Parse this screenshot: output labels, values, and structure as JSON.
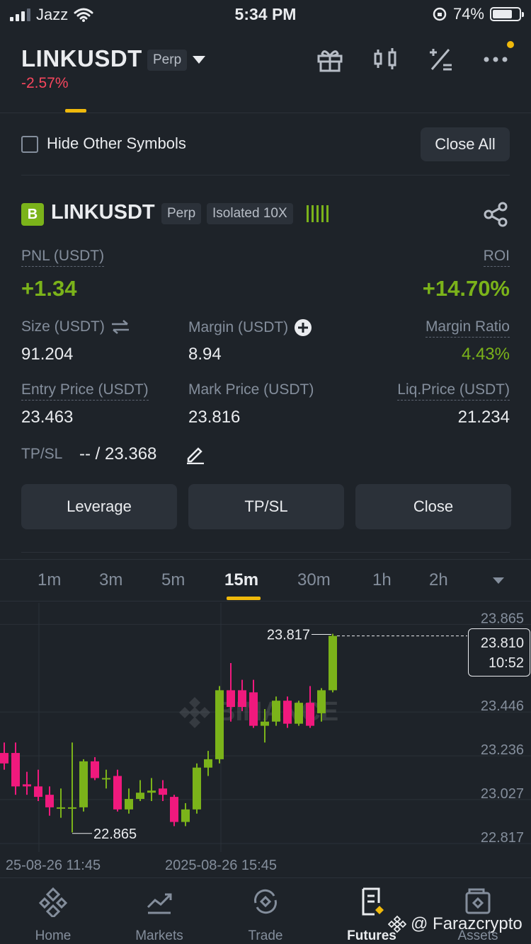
{
  "status_bar": {
    "carrier": "Jazz",
    "time": "5:34 PM",
    "battery": "74%"
  },
  "header": {
    "symbol": "LINKUSDT",
    "contract": "Perp",
    "change": "-2.57%"
  },
  "filter": {
    "hide_label": "Hide Other Symbols",
    "close_all": "Close All"
  },
  "position": {
    "badge": "B",
    "symbol": "LINKUSDT",
    "contract": "Perp",
    "margin_mode": "Isolated 10X",
    "pnl_label": "PNL (USDT)",
    "pnl": "+1.34",
    "roi_label": "ROI",
    "roi": "+14.70%",
    "size_label": "Size (USDT)",
    "size": "91.204",
    "margin_label": "Margin (USDT)",
    "margin": "8.94",
    "margin_ratio_label": "Margin Ratio",
    "margin_ratio": "4.43%",
    "entry_label": "Entry Price (USDT)",
    "entry": "23.463",
    "mark_label": "Mark Price (USDT)",
    "mark": "23.816",
    "liq_label": "Liq.Price (USDT)",
    "liq": "21.234",
    "tpsl_label": "TP/SL",
    "tpsl": "-- / 23.368"
  },
  "actions": {
    "leverage": "Leverage",
    "tpsl": "TP/SL",
    "close": "Close"
  },
  "timeframes": [
    "1m",
    "3m",
    "5m",
    "15m",
    "30m",
    "1h",
    "2h"
  ],
  "active_timeframe": "15m",
  "chart_data": {
    "type": "candlestick",
    "y_ticks": [
      "23.865",
      "23.446",
      "23.236",
      "23.027",
      "22.817"
    ],
    "x_ticks": [
      "25-08-26 11:45",
      "2025-08-26 15:45"
    ],
    "ylim": [
      22.8,
      23.9
    ],
    "high_label": "23.817",
    "low_label": "22.865",
    "current_price": "23.810",
    "countdown": "10:52",
    "watermark": "BINANCE",
    "up_color": "#7bb31a",
    "down_color": "#f0197d",
    "candles": [
      {
        "o": 23.25,
        "h": 23.3,
        "l": 23.17,
        "c": 23.2
      },
      {
        "o": 23.25,
        "h": 23.3,
        "l": 23.05,
        "c": 23.09
      },
      {
        "o": 23.1,
        "h": 23.16,
        "l": 23.05,
        "c": 23.09
      },
      {
        "o": 23.09,
        "h": 23.17,
        "l": 23.02,
        "c": 23.04
      },
      {
        "o": 23.05,
        "h": 23.09,
        "l": 22.95,
        "c": 22.99
      },
      {
        "o": 22.99,
        "h": 23.08,
        "l": 22.94,
        "c": 22.99
      },
      {
        "o": 22.99,
        "h": 23.3,
        "l": 22.87,
        "c": 22.99
      },
      {
        "o": 22.99,
        "h": 23.22,
        "l": 22.97,
        "c": 23.21
      },
      {
        "o": 23.21,
        "h": 23.23,
        "l": 23.12,
        "c": 23.13
      },
      {
        "o": 23.13,
        "h": 23.17,
        "l": 23.08,
        "c": 23.13
      },
      {
        "o": 23.14,
        "h": 23.17,
        "l": 22.97,
        "c": 22.98
      },
      {
        "o": 22.98,
        "h": 23.08,
        "l": 22.96,
        "c": 23.03
      },
      {
        "o": 23.03,
        "h": 23.12,
        "l": 23.02,
        "c": 23.06
      },
      {
        "o": 23.06,
        "h": 23.13,
        "l": 23.02,
        "c": 23.07
      },
      {
        "o": 23.08,
        "h": 23.12,
        "l": 23.02,
        "c": 23.05
      },
      {
        "o": 23.04,
        "h": 23.05,
        "l": 22.9,
        "c": 22.92
      },
      {
        "o": 22.92,
        "h": 23.01,
        "l": 22.9,
        "c": 22.98
      },
      {
        "o": 22.98,
        "h": 23.2,
        "l": 22.96,
        "c": 23.18
      },
      {
        "o": 23.18,
        "h": 23.26,
        "l": 23.14,
        "c": 23.22
      },
      {
        "o": 23.22,
        "h": 23.57,
        "l": 23.2,
        "c": 23.55
      },
      {
        "o": 23.55,
        "h": 23.68,
        "l": 23.4,
        "c": 23.47
      },
      {
        "o": 23.55,
        "h": 23.6,
        "l": 23.45,
        "c": 23.47
      },
      {
        "o": 23.54,
        "h": 23.6,
        "l": 23.37,
        "c": 23.38
      },
      {
        "o": 23.38,
        "h": 23.46,
        "l": 23.3,
        "c": 23.4
      },
      {
        "o": 23.4,
        "h": 23.52,
        "l": 23.38,
        "c": 23.5
      },
      {
        "o": 23.5,
        "h": 23.52,
        "l": 23.37,
        "c": 23.39
      },
      {
        "o": 23.39,
        "h": 23.5,
        "l": 23.38,
        "c": 23.49
      },
      {
        "o": 23.49,
        "h": 23.57,
        "l": 23.37,
        "c": 23.38
      },
      {
        "o": 23.44,
        "h": 23.56,
        "l": 23.4,
        "c": 23.55
      },
      {
        "o": 23.55,
        "h": 23.82,
        "l": 23.54,
        "c": 23.81
      }
    ]
  },
  "nav": [
    {
      "label": "Home",
      "icon": "home-icon"
    },
    {
      "label": "Markets",
      "icon": "markets-icon"
    },
    {
      "label": "Trade",
      "icon": "trade-icon"
    },
    {
      "label": "Futures",
      "icon": "futures-icon"
    },
    {
      "label": "Assets",
      "icon": "assets-icon"
    }
  ],
  "watermark_text": "@ Farazcrypto"
}
